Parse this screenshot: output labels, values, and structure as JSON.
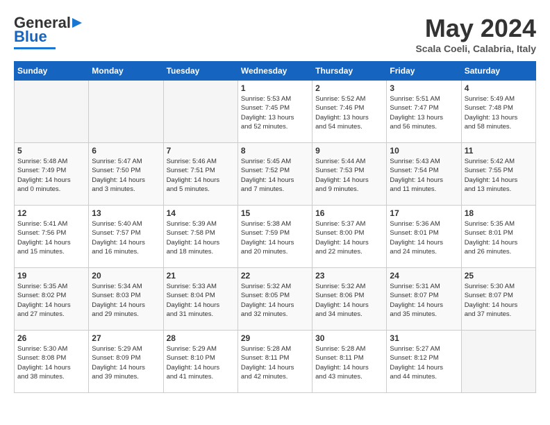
{
  "header": {
    "logo_general": "General",
    "logo_blue": "Blue",
    "month": "May 2024",
    "location": "Scala Coeli, Calabria, Italy"
  },
  "days_of_week": [
    "Sunday",
    "Monday",
    "Tuesday",
    "Wednesday",
    "Thursday",
    "Friday",
    "Saturday"
  ],
  "weeks": [
    [
      {
        "day": "",
        "info": ""
      },
      {
        "day": "",
        "info": ""
      },
      {
        "day": "",
        "info": ""
      },
      {
        "day": "1",
        "info": "Sunrise: 5:53 AM\nSunset: 7:45 PM\nDaylight: 13 hours\nand 52 minutes."
      },
      {
        "day": "2",
        "info": "Sunrise: 5:52 AM\nSunset: 7:46 PM\nDaylight: 13 hours\nand 54 minutes."
      },
      {
        "day": "3",
        "info": "Sunrise: 5:51 AM\nSunset: 7:47 PM\nDaylight: 13 hours\nand 56 minutes."
      },
      {
        "day": "4",
        "info": "Sunrise: 5:49 AM\nSunset: 7:48 PM\nDaylight: 13 hours\nand 58 minutes."
      }
    ],
    [
      {
        "day": "5",
        "info": "Sunrise: 5:48 AM\nSunset: 7:49 PM\nDaylight: 14 hours\nand 0 minutes."
      },
      {
        "day": "6",
        "info": "Sunrise: 5:47 AM\nSunset: 7:50 PM\nDaylight: 14 hours\nand 3 minutes."
      },
      {
        "day": "7",
        "info": "Sunrise: 5:46 AM\nSunset: 7:51 PM\nDaylight: 14 hours\nand 5 minutes."
      },
      {
        "day": "8",
        "info": "Sunrise: 5:45 AM\nSunset: 7:52 PM\nDaylight: 14 hours\nand 7 minutes."
      },
      {
        "day": "9",
        "info": "Sunrise: 5:44 AM\nSunset: 7:53 PM\nDaylight: 14 hours\nand 9 minutes."
      },
      {
        "day": "10",
        "info": "Sunrise: 5:43 AM\nSunset: 7:54 PM\nDaylight: 14 hours\nand 11 minutes."
      },
      {
        "day": "11",
        "info": "Sunrise: 5:42 AM\nSunset: 7:55 PM\nDaylight: 14 hours\nand 13 minutes."
      }
    ],
    [
      {
        "day": "12",
        "info": "Sunrise: 5:41 AM\nSunset: 7:56 PM\nDaylight: 14 hours\nand 15 minutes."
      },
      {
        "day": "13",
        "info": "Sunrise: 5:40 AM\nSunset: 7:57 PM\nDaylight: 14 hours\nand 16 minutes."
      },
      {
        "day": "14",
        "info": "Sunrise: 5:39 AM\nSunset: 7:58 PM\nDaylight: 14 hours\nand 18 minutes."
      },
      {
        "day": "15",
        "info": "Sunrise: 5:38 AM\nSunset: 7:59 PM\nDaylight: 14 hours\nand 20 minutes."
      },
      {
        "day": "16",
        "info": "Sunrise: 5:37 AM\nSunset: 8:00 PM\nDaylight: 14 hours\nand 22 minutes."
      },
      {
        "day": "17",
        "info": "Sunrise: 5:36 AM\nSunset: 8:01 PM\nDaylight: 14 hours\nand 24 minutes."
      },
      {
        "day": "18",
        "info": "Sunrise: 5:35 AM\nSunset: 8:01 PM\nDaylight: 14 hours\nand 26 minutes."
      }
    ],
    [
      {
        "day": "19",
        "info": "Sunrise: 5:35 AM\nSunset: 8:02 PM\nDaylight: 14 hours\nand 27 minutes."
      },
      {
        "day": "20",
        "info": "Sunrise: 5:34 AM\nSunset: 8:03 PM\nDaylight: 14 hours\nand 29 minutes."
      },
      {
        "day": "21",
        "info": "Sunrise: 5:33 AM\nSunset: 8:04 PM\nDaylight: 14 hours\nand 31 minutes."
      },
      {
        "day": "22",
        "info": "Sunrise: 5:32 AM\nSunset: 8:05 PM\nDaylight: 14 hours\nand 32 minutes."
      },
      {
        "day": "23",
        "info": "Sunrise: 5:32 AM\nSunset: 8:06 PM\nDaylight: 14 hours\nand 34 minutes."
      },
      {
        "day": "24",
        "info": "Sunrise: 5:31 AM\nSunset: 8:07 PM\nDaylight: 14 hours\nand 35 minutes."
      },
      {
        "day": "25",
        "info": "Sunrise: 5:30 AM\nSunset: 8:07 PM\nDaylight: 14 hours\nand 37 minutes."
      }
    ],
    [
      {
        "day": "26",
        "info": "Sunrise: 5:30 AM\nSunset: 8:08 PM\nDaylight: 14 hours\nand 38 minutes."
      },
      {
        "day": "27",
        "info": "Sunrise: 5:29 AM\nSunset: 8:09 PM\nDaylight: 14 hours\nand 39 minutes."
      },
      {
        "day": "28",
        "info": "Sunrise: 5:29 AM\nSunset: 8:10 PM\nDaylight: 14 hours\nand 41 minutes."
      },
      {
        "day": "29",
        "info": "Sunrise: 5:28 AM\nSunset: 8:11 PM\nDaylight: 14 hours\nand 42 minutes."
      },
      {
        "day": "30",
        "info": "Sunrise: 5:28 AM\nSunset: 8:11 PM\nDaylight: 14 hours\nand 43 minutes."
      },
      {
        "day": "31",
        "info": "Sunrise: 5:27 AM\nSunset: 8:12 PM\nDaylight: 14 hours\nand 44 minutes."
      },
      {
        "day": "",
        "info": ""
      }
    ]
  ]
}
